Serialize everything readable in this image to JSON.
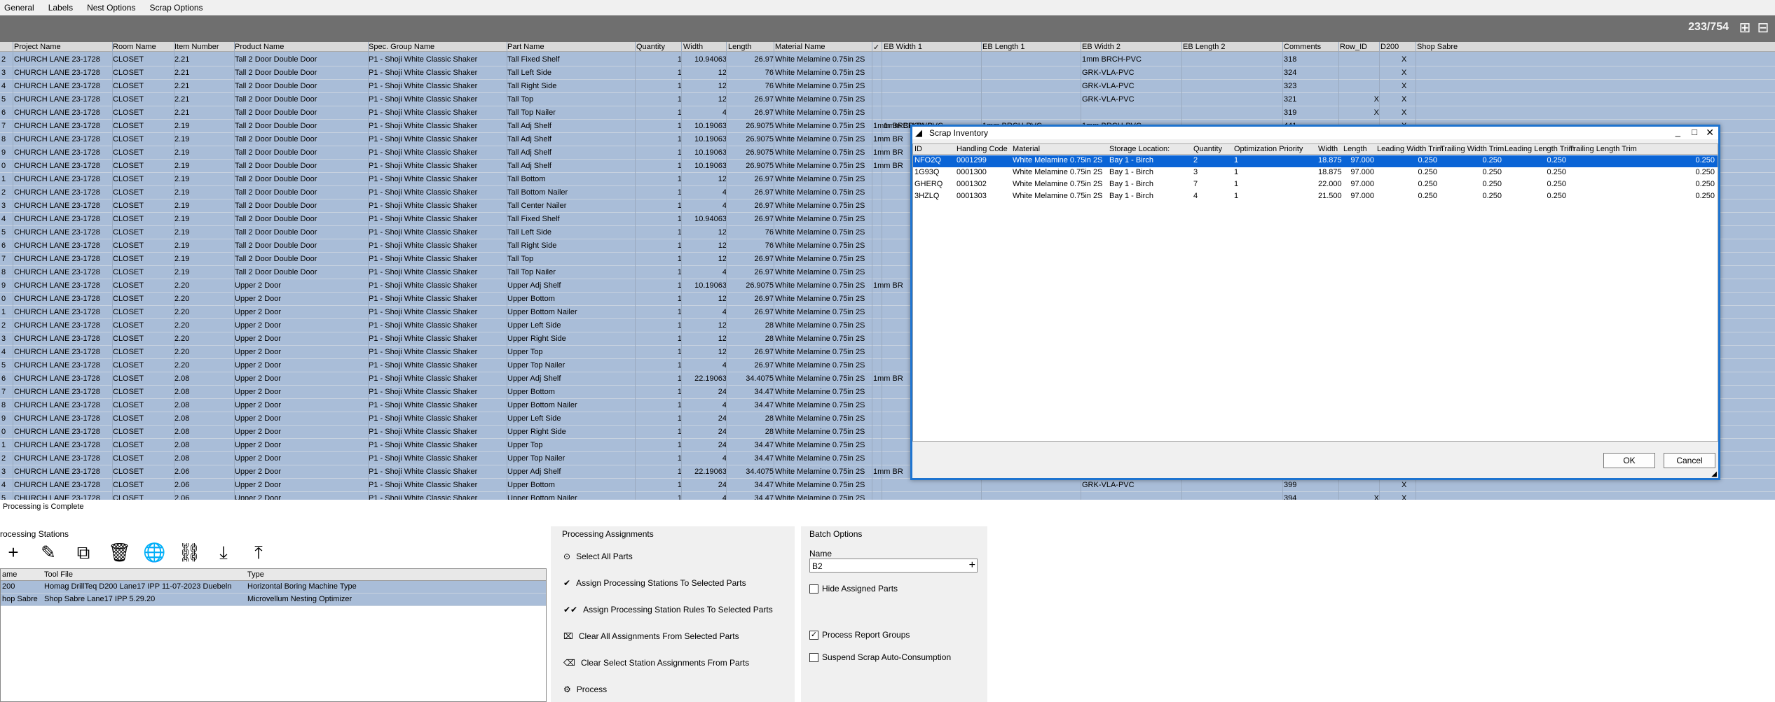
{
  "menu": [
    "General",
    "Labels",
    "Nest Options",
    "Scrap Options"
  ],
  "record_count": "233/754",
  "grid": {
    "headers": [
      "Project Name",
      "Room Name",
      "Item Number",
      "Product Name",
      "Spec. Group Name",
      "Part Name",
      "Quantity",
      "Width",
      "Length",
      "Material Name",
      "✓",
      "EB Width 1",
      "EB Length 1",
      "EB Width 2",
      "EB Length 2",
      "Comments",
      "Row_ID",
      "D200",
      "Shop Sabre"
    ],
    "rows": [
      [
        "2",
        "CHURCH LANE 23-1728",
        "CLOSET",
        "2.21",
        "Tall 2 Door Double Door",
        "P1 - Shoji White Classic Shaker",
        "Tall Fixed Shelf",
        "1",
        "10.94063",
        "26.97",
        "White Melamine 0.75in 2S",
        "",
        "",
        "",
        "1mm BRCH-PVC",
        "",
        "318",
        "",
        "X"
      ],
      [
        "3",
        "CHURCH LANE 23-1728",
        "CLOSET",
        "2.21",
        "Tall 2 Door Double Door",
        "P1 - Shoji White Classic Shaker",
        "Tall Left Side",
        "1",
        "12",
        "76",
        "White Melamine 0.75in 2S",
        "",
        "",
        "",
        "GRK-VLA-PVC",
        "",
        "324",
        "",
        "X"
      ],
      [
        "4",
        "CHURCH LANE 23-1728",
        "CLOSET",
        "2.21",
        "Tall 2 Door Double Door",
        "P1 - Shoji White Classic Shaker",
        "Tall Right Side",
        "1",
        "12",
        "76",
        "White Melamine 0.75in 2S",
        "",
        "",
        "",
        "GRK-VLA-PVC",
        "",
        "323",
        "",
        "X"
      ],
      [
        "5",
        "CHURCH LANE 23-1728",
        "CLOSET",
        "2.21",
        "Tall 2 Door Double Door",
        "P1 - Shoji White Classic Shaker",
        "Tall Top",
        "1",
        "12",
        "26.97",
        "White Melamine 0.75in 2S",
        "",
        "",
        "",
        "GRK-VLA-PVC",
        "",
        "321",
        "X",
        "X"
      ],
      [
        "6",
        "CHURCH LANE 23-1728",
        "CLOSET",
        "2.21",
        "Tall 2 Door Double Door",
        "P1 - Shoji White Classic Shaker",
        "Tall Top Nailer",
        "1",
        "4",
        "26.97",
        "White Melamine 0.75in 2S",
        "",
        "",
        "",
        "",
        "",
        "319",
        "X",
        "X"
      ],
      [
        "7",
        "CHURCH LANE 23-1728",
        "CLOSET",
        "2.19",
        "Tall 2 Door Double Door",
        "P1 - Shoji White Classic Shaker",
        "Tall Adj Shelf",
        "1",
        "10.19063",
        "26.9075",
        "White Melamine 0.75in 2S",
        "1mm BRCH-PVC",
        "1mm BRCH-PVC",
        "1mm BRCH-PVC",
        "1mm BRCH-PVC",
        "",
        "441",
        "",
        "X"
      ],
      [
        "8",
        "CHURCH LANE 23-1728",
        "CLOSET",
        "2.19",
        "Tall 2 Door Double Door",
        "P1 - Shoji White Classic Shaker",
        "Tall Adj Shelf",
        "1",
        "10.19063",
        "26.9075",
        "White Melamine 0.75in 2S",
        "1mm BR",
        "",
        "",
        "",
        "",
        "",
        "",
        ""
      ],
      [
        "9",
        "CHURCH LANE 23-1728",
        "CLOSET",
        "2.19",
        "Tall 2 Door Double Door",
        "P1 - Shoji White Classic Shaker",
        "Tall Adj Shelf",
        "1",
        "10.19063",
        "26.9075",
        "White Melamine 0.75in 2S",
        "1mm BR",
        "",
        "",
        "",
        "",
        "",
        "",
        ""
      ],
      [
        "0",
        "CHURCH LANE 23-1728",
        "CLOSET",
        "2.19",
        "Tall 2 Door Double Door",
        "P1 - Shoji White Classic Shaker",
        "Tall Adj Shelf",
        "1",
        "10.19063",
        "26.9075",
        "White Melamine 0.75in 2S",
        "1mm BR",
        "",
        "",
        "",
        "",
        "",
        "",
        ""
      ],
      [
        "1",
        "CHURCH LANE 23-1728",
        "CLOSET",
        "2.19",
        "Tall 2 Door Double Door",
        "P1 - Shoji White Classic Shaker",
        "Tall Bottom",
        "1",
        "12",
        "26.97",
        "White Melamine 0.75in 2S",
        "",
        "",
        "",
        "",
        "",
        "",
        "",
        ""
      ],
      [
        "2",
        "CHURCH LANE 23-1728",
        "CLOSET",
        "2.19",
        "Tall 2 Door Double Door",
        "P1 - Shoji White Classic Shaker",
        "Tall Bottom Nailer",
        "1",
        "4",
        "26.97",
        "White Melamine 0.75in 2S",
        "",
        "",
        "",
        "",
        "",
        "",
        "",
        ""
      ],
      [
        "3",
        "CHURCH LANE 23-1728",
        "CLOSET",
        "2.19",
        "Tall 2 Door Double Door",
        "P1 - Shoji White Classic Shaker",
        "Tall Center Nailer",
        "1",
        "4",
        "26.97",
        "White Melamine 0.75in 2S",
        "",
        "",
        "",
        "",
        "",
        "",
        "",
        ""
      ],
      [
        "4",
        "CHURCH LANE 23-1728",
        "CLOSET",
        "2.19",
        "Tall 2 Door Double Door",
        "P1 - Shoji White Classic Shaker",
        "Tall Fixed Shelf",
        "1",
        "10.94063",
        "26.97",
        "White Melamine 0.75in 2S",
        "",
        "",
        "",
        "",
        "",
        "",
        "",
        ""
      ],
      [
        "5",
        "CHURCH LANE 23-1728",
        "CLOSET",
        "2.19",
        "Tall 2 Door Double Door",
        "P1 - Shoji White Classic Shaker",
        "Tall Left Side",
        "1",
        "12",
        "76",
        "White Melamine 0.75in 2S",
        "",
        "",
        "",
        "",
        "",
        "",
        "",
        ""
      ],
      [
        "6",
        "CHURCH LANE 23-1728",
        "CLOSET",
        "2.19",
        "Tall 2 Door Double Door",
        "P1 - Shoji White Classic Shaker",
        "Tall Right Side",
        "1",
        "12",
        "76",
        "White Melamine 0.75in 2S",
        "",
        "",
        "",
        "",
        "",
        "",
        "",
        ""
      ],
      [
        "7",
        "CHURCH LANE 23-1728",
        "CLOSET",
        "2.19",
        "Tall 2 Door Double Door",
        "P1 - Shoji White Classic Shaker",
        "Tall Top",
        "1",
        "12",
        "26.97",
        "White Melamine 0.75in 2S",
        "",
        "",
        "",
        "",
        "",
        "",
        "",
        ""
      ],
      [
        "8",
        "CHURCH LANE 23-1728",
        "CLOSET",
        "2.19",
        "Tall 2 Door Double Door",
        "P1 - Shoji White Classic Shaker",
        "Tall Top Nailer",
        "1",
        "4",
        "26.97",
        "White Melamine 0.75in 2S",
        "",
        "",
        "",
        "",
        "",
        "",
        "",
        ""
      ],
      [
        "9",
        "CHURCH LANE 23-1728",
        "CLOSET",
        "2.20",
        "Upper 2 Door",
        "P1 - Shoji White Classic Shaker",
        "Upper Adj Shelf",
        "1",
        "10.19063",
        "26.9075",
        "White Melamine 0.75in 2S",
        "1mm BR",
        "",
        "",
        "",
        "",
        "",
        "",
        ""
      ],
      [
        "0",
        "CHURCH LANE 23-1728",
        "CLOSET",
        "2.20",
        "Upper 2 Door",
        "P1 - Shoji White Classic Shaker",
        "Upper Bottom",
        "1",
        "12",
        "26.97",
        "White Melamine 0.75in 2S",
        "",
        "",
        "",
        "",
        "",
        "",
        "",
        ""
      ],
      [
        "1",
        "CHURCH LANE 23-1728",
        "CLOSET",
        "2.20",
        "Upper 2 Door",
        "P1 - Shoji White Classic Shaker",
        "Upper Bottom Nailer",
        "1",
        "4",
        "26.97",
        "White Melamine 0.75in 2S",
        "",
        "",
        "",
        "",
        "",
        "",
        "",
        ""
      ],
      [
        "2",
        "CHURCH LANE 23-1728",
        "CLOSET",
        "2.20",
        "Upper 2 Door",
        "P1 - Shoji White Classic Shaker",
        "Upper Left Side",
        "1",
        "12",
        "28",
        "White Melamine 0.75in 2S",
        "",
        "",
        "",
        "",
        "",
        "",
        "",
        ""
      ],
      [
        "3",
        "CHURCH LANE 23-1728",
        "CLOSET",
        "2.20",
        "Upper 2 Door",
        "P1 - Shoji White Classic Shaker",
        "Upper Right Side",
        "1",
        "12",
        "28",
        "White Melamine 0.75in 2S",
        "",
        "",
        "",
        "",
        "",
        "",
        "",
        ""
      ],
      [
        "4",
        "CHURCH LANE 23-1728",
        "CLOSET",
        "2.20",
        "Upper 2 Door",
        "P1 - Shoji White Classic Shaker",
        "Upper Top",
        "1",
        "12",
        "26.97",
        "White Melamine 0.75in 2S",
        "",
        "",
        "",
        "",
        "",
        "",
        "",
        ""
      ],
      [
        "5",
        "CHURCH LANE 23-1728",
        "CLOSET",
        "2.20",
        "Upper 2 Door",
        "P1 - Shoji White Classic Shaker",
        "Upper Top Nailer",
        "1",
        "4",
        "26.97",
        "White Melamine 0.75in 2S",
        "",
        "",
        "",
        "",
        "",
        "",
        "",
        ""
      ],
      [
        "6",
        "CHURCH LANE 23-1728",
        "CLOSET",
        "2.08",
        "Upper 2 Door",
        "P1 - Shoji White Classic Shaker",
        "Upper Adj Shelf",
        "1",
        "22.19063",
        "34.4075",
        "White Melamine 0.75in 2S",
        "1mm BR",
        "",
        "",
        "",
        "",
        "",
        "",
        ""
      ],
      [
        "7",
        "CHURCH LANE 23-1728",
        "CLOSET",
        "2.08",
        "Upper 2 Door",
        "P1 - Shoji White Classic Shaker",
        "Upper Bottom",
        "1",
        "24",
        "34.47",
        "White Melamine 0.75in 2S",
        "",
        "",
        "",
        "",
        "",
        "",
        "",
        ""
      ],
      [
        "8",
        "CHURCH LANE 23-1728",
        "CLOSET",
        "2.08",
        "Upper 2 Door",
        "P1 - Shoji White Classic Shaker",
        "Upper Bottom Nailer",
        "1",
        "4",
        "34.47",
        "White Melamine 0.75in 2S",
        "",
        "",
        "",
        "",
        "",
        "",
        "",
        ""
      ],
      [
        "9",
        "CHURCH LANE 23-1728",
        "CLOSET",
        "2.08",
        "Upper 2 Door",
        "P1 - Shoji White Classic Shaker",
        "Upper Left Side",
        "1",
        "24",
        "28",
        "White Melamine 0.75in 2S",
        "",
        "",
        "",
        "",
        "",
        "",
        "",
        ""
      ],
      [
        "0",
        "CHURCH LANE 23-1728",
        "CLOSET",
        "2.08",
        "Upper 2 Door",
        "P1 - Shoji White Classic Shaker",
        "Upper Right Side",
        "1",
        "24",
        "28",
        "White Melamine 0.75in 2S",
        "",
        "",
        "",
        "",
        "",
        "",
        "",
        ""
      ],
      [
        "1",
        "CHURCH LANE 23-1728",
        "CLOSET",
        "2.08",
        "Upper 2 Door",
        "P1 - Shoji White Classic Shaker",
        "Upper Top",
        "1",
        "24",
        "34.47",
        "White Melamine 0.75in 2S",
        "",
        "",
        "",
        "",
        "",
        "",
        "",
        ""
      ],
      [
        "2",
        "CHURCH LANE 23-1728",
        "CLOSET",
        "2.08",
        "Upper 2 Door",
        "P1 - Shoji White Classic Shaker",
        "Upper Top Nailer",
        "1",
        "4",
        "34.47",
        "White Melamine 0.75in 2S",
        "",
        "",
        "",
        "",
        "",
        "",
        "",
        ""
      ],
      [
        "3",
        "CHURCH LANE 23-1728",
        "CLOSET",
        "2.06",
        "Upper 2 Door",
        "P1 - Shoji White Classic Shaker",
        "Upper Adj Shelf",
        "1",
        "22.19063",
        "34.4075",
        "White Melamine 0.75in 2S",
        "1mm BR",
        "",
        "",
        "",
        "",
        "",
        "",
        ""
      ],
      [
        "4",
        "CHURCH LANE 23-1728",
        "CLOSET",
        "2.06",
        "Upper 2 Door",
        "P1 - Shoji White Classic Shaker",
        "Upper Bottom",
        "1",
        "24",
        "34.47",
        "White Melamine 0.75in 2S",
        "",
        "",
        "",
        "GRK-VLA-PVC",
        "",
        "399",
        "",
        "X"
      ],
      [
        "5",
        "CHURCH LANE 23-1728",
        "CLOSET",
        "2.06",
        "Upper 2 Door",
        "P1 - Shoji White Classic Shaker",
        "Upper Bottom Nailer",
        "1",
        "4",
        "34.47",
        "White Melamine 0.75in 2S",
        "",
        "",
        "",
        "",
        "",
        "394",
        "X",
        "X"
      ]
    ]
  },
  "status_text": "Processing is Complete",
  "stations": {
    "title": "rocessing Stations",
    "headers": [
      "ame",
      "Tool File",
      "Type"
    ],
    "rows": [
      [
        "200",
        "Homag DrillTeq D200 Lane17 IPP 11-07-2023 Duebeln",
        "Horizontal Boring Machine Type"
      ],
      [
        "hop Sabre",
        "Shop Sabre Lane17 IPP 5.29.20",
        "Microvellum Nesting Optimizer"
      ]
    ]
  },
  "assignments": {
    "title": "Processing Assignments",
    "items": [
      "Select All Parts",
      "Assign Processing Stations To Selected Parts",
      "Assign Processing Station Rules To Selected Parts",
      "Clear All Assignments From Selected Parts",
      "Clear Select Station Assignments From Parts",
      "Process"
    ]
  },
  "batch": {
    "title": "Batch Options",
    "name_label": "Name",
    "name_value": "B2",
    "hide_assigned": "Hide Assigned Parts",
    "process_report": "Process Report Groups",
    "suspend_scrap": "Suspend Scrap Auto-Consumption"
  },
  "dialog": {
    "title": "Scrap Inventory",
    "headers": [
      "ID",
      "Handling Code",
      "Material",
      "Storage Location:",
      "Quantity",
      "Optimization Priority",
      "Width",
      "Length",
      "Leading Width Trim",
      "Trailing Width Trim",
      "Leading Length Trim",
      "Trailing Length Trim"
    ],
    "rows": [
      [
        "NFO2Q",
        "0001299",
        "White Melamine 0.75in 2S",
        "Bay 1 - Birch",
        "2",
        "1",
        "18.875",
        "97.000",
        "0.250",
        "0.250",
        "0.250",
        "0.250"
      ],
      [
        "1G93Q",
        "0001300",
        "White Melamine 0.75in 2S",
        "Bay 1 - Birch",
        "3",
        "1",
        "18.875",
        "97.000",
        "0.250",
        "0.250",
        "0.250",
        "0.250"
      ],
      [
        "GHERQ",
        "0001302",
        "White Melamine 0.75in 2S",
        "Bay 1 - Birch",
        "7",
        "1",
        "22.000",
        "97.000",
        "0.250",
        "0.250",
        "0.250",
        "0.250"
      ],
      [
        "3HZLQ",
        "0001303",
        "White Melamine 0.75in 2S",
        "Bay 1 - Birch",
        "4",
        "1",
        "21.500",
        "97.000",
        "0.250",
        "0.250",
        "0.250",
        "0.250"
      ]
    ],
    "ok": "OK",
    "cancel": "Cancel"
  }
}
